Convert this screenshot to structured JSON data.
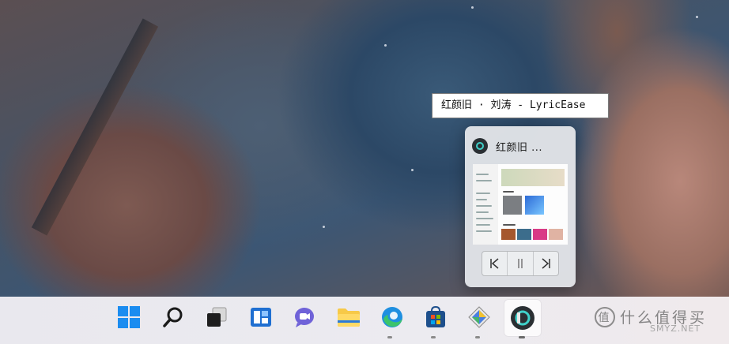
{
  "tooltip": {
    "text": "红颜旧 · 刘涛 - LyricEase"
  },
  "preview": {
    "title": "红颜旧 ...",
    "controls": {
      "previous": "|<",
      "pause": "||",
      "next": ">|"
    }
  },
  "taskbar": {
    "items": [
      {
        "name": "start-button",
        "icon": "windows-logo-icon"
      },
      {
        "name": "search-button",
        "icon": "search-icon"
      },
      {
        "name": "task-view-button",
        "icon": "task-view-icon"
      },
      {
        "name": "widgets-button",
        "icon": "widgets-icon"
      },
      {
        "name": "teams-chat-button",
        "icon": "chat-icon"
      },
      {
        "name": "file-explorer-button",
        "icon": "folder-icon"
      },
      {
        "name": "edge-button",
        "icon": "edge-icon"
      },
      {
        "name": "store-button",
        "icon": "store-icon"
      },
      {
        "name": "app-button",
        "icon": "app-icon"
      },
      {
        "name": "lyricease-button",
        "icon": "lyricease-icon"
      }
    ]
  },
  "watermark": {
    "text": "什么值得买",
    "sub": "SMYZ.NET",
    "logo": "值"
  },
  "colors": {
    "accent": "#0078d4",
    "app_teal": "#3fd0c9"
  }
}
